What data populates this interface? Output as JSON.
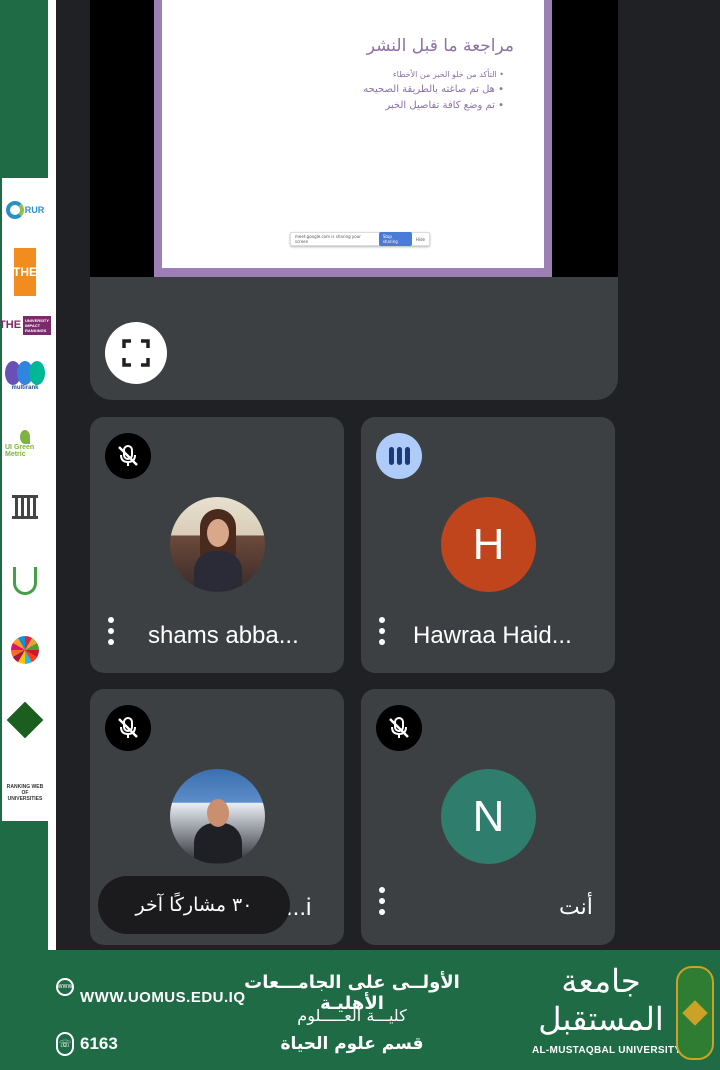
{
  "slide": {
    "title": "مراجعة ما قبل النشر",
    "bullets": [
      "التأكد من خلو الخبر من الأخطاء",
      "هل تم صاغته بالطريقة الصحيحه",
      "تم وضع كافة تفاصيل الخبر"
    ],
    "share_bar_text": "meet.google.com is sharing your screen",
    "stop_label": "Stop sharing",
    "hide_label": "Hide"
  },
  "tiles": [
    {
      "name": "shams abba...",
      "state": "muted",
      "avatar": "photo"
    },
    {
      "name": "Hawraa Haid...",
      "state": "speaking",
      "avatar_letter": "H",
      "avatar_color": "#c0451d"
    },
    {
      "name": "...i",
      "state": "muted",
      "avatar": "photo"
    },
    {
      "name": "أنت",
      "state": "muted",
      "avatar_letter": "N",
      "avatar_color": "#2f7d6c"
    }
  ],
  "participants_pill": "٣٠ مشاركًا آخر",
  "icons": {
    "fullscreen": "fullscreen-icon",
    "mic_off": "mic-off-icon",
    "speaking": "speaking-indicator-icon",
    "more": "more-vert-icon"
  },
  "logos": {
    "rur": "RUR",
    "the": "THE",
    "the_impact": "THE",
    "the_impact_box": "UNIVERSITY IMPACT RANKINGS",
    "multirank": "multirank",
    "greenmetric": "UI Green Metric",
    "rwu": "RANKING WEB OF UNIVERSITIES"
  },
  "footer": {
    "url": "WWW.UOMUS.EDU.IQ",
    "phone": "6163",
    "web_icon_text": "WWW",
    "line1": "الأولــى على الجامـــعات الأهليـة",
    "line2": "كليـــة العـــــلوم",
    "line3": "قسم علوم الحياة",
    "university_ar": "جامعة المستقبل",
    "university_en": "AL-MUSTAQBAL UNIVERSITY"
  },
  "colors": {
    "frame_green": "#1f6b45",
    "meet_bg": "#202124",
    "tile_bg": "#3c4043",
    "slide_border": "#9b7fb5"
  }
}
